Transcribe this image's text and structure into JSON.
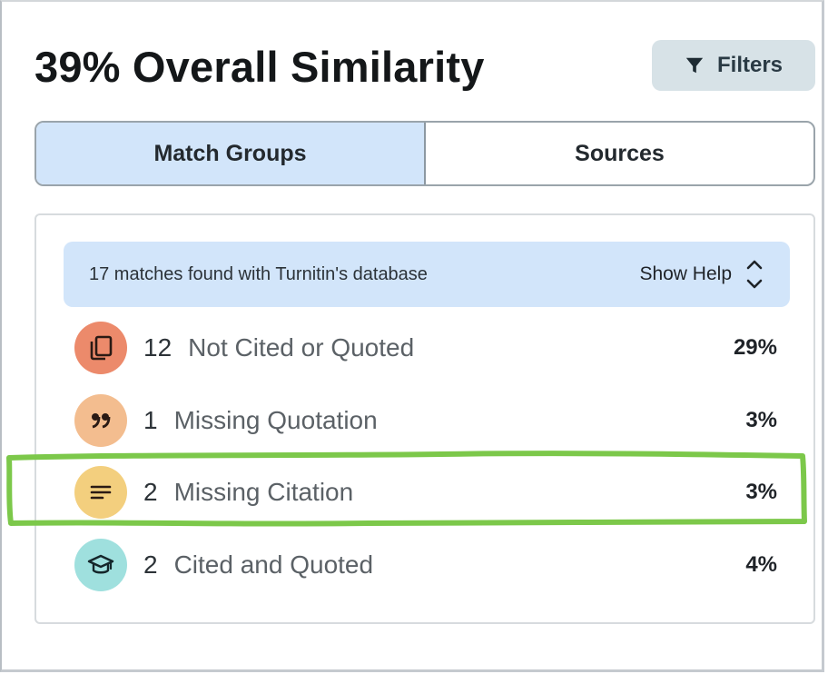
{
  "header": {
    "title": "39% Overall Similarity",
    "filters_label": "Filters"
  },
  "tabs": [
    {
      "label": "Match Groups",
      "active": true
    },
    {
      "label": "Sources",
      "active": false
    }
  ],
  "banner": {
    "text": "17 matches found with Turnitin's database",
    "help_label": "Show Help"
  },
  "groups": [
    {
      "count": "12",
      "label": "Not Cited or Quoted",
      "percent": "29%",
      "icon": "copy-icon",
      "color": "#ec8a6b"
    },
    {
      "count": "1",
      "label": "Missing Quotation",
      "percent": "3%",
      "icon": "quote-icon",
      "color": "#f3bd8f"
    },
    {
      "count": "2",
      "label": "Missing Citation",
      "percent": "3%",
      "icon": "lines-icon",
      "color": "#f3cf7e"
    },
    {
      "count": "2",
      "label": "Cited and Quoted",
      "percent": "4%",
      "icon": "graduation-cap-icon",
      "color": "#9fe0de"
    }
  ],
  "annotation": {
    "color": "#7cc84a",
    "target": "Missing Citation"
  }
}
